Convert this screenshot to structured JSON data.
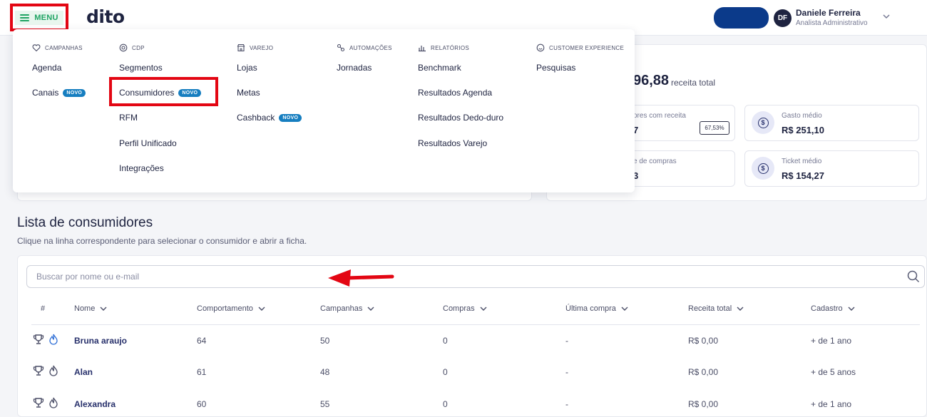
{
  "header": {
    "menu_label": "MENU",
    "logo": "dito",
    "user": {
      "initials": "DF",
      "name": "Daniele Ferreira",
      "role": "Analista Administrativo"
    }
  },
  "menu": {
    "columns": [
      {
        "category": "CAMPANHAS",
        "icon": "heart-icon",
        "items": [
          {
            "label": "Agenda"
          },
          {
            "label": "Canais",
            "badge": "NOVO"
          }
        ]
      },
      {
        "category": "CDP",
        "icon": "cdp-icon",
        "items": [
          {
            "label": "Segmentos"
          },
          {
            "label": "Consumidores",
            "badge": "NOVO"
          },
          {
            "label": "RFM"
          },
          {
            "label": "Perfil Unificado"
          },
          {
            "label": "Integrações"
          }
        ]
      },
      {
        "category": "VAREJO",
        "icon": "store-icon",
        "items": [
          {
            "label": "Lojas"
          },
          {
            "label": "Metas"
          },
          {
            "label": "Cashback",
            "badge": "NOVO"
          }
        ]
      },
      {
        "category": "AUTOMAÇÕES",
        "icon": "automation-icon",
        "items": [
          {
            "label": "Jornadas"
          }
        ]
      },
      {
        "category": "RELATÓRIOS",
        "icon": "chart-icon",
        "items": [
          {
            "label": "Benchmark"
          },
          {
            "label": "Resultados Agenda"
          },
          {
            "label": "Resultados Dedo-duro"
          },
          {
            "label": "Resultados Varejo"
          }
        ]
      },
      {
        "category": "CUSTOMER EXPERIENCE",
        "icon": "smile-icon",
        "items": [
          {
            "label": "Pesquisas"
          }
        ]
      }
    ]
  },
  "summary": {
    "revenue_value": "96,88",
    "revenue_label": "receita total",
    "stats": [
      {
        "label": "ores com receita",
        "value": "7",
        "badge": "67,53%"
      },
      {
        "label": "Gasto médio",
        "value": "R$ 251,10"
      },
      {
        "label": "e de compras",
        "value": "3"
      },
      {
        "label": "Ticket médio",
        "value": "R$ 154,27"
      }
    ]
  },
  "list": {
    "title": "Lista de consumidores",
    "subtitle": "Clique na linha correspondente para selecionar o consumidor e abrir a ficha.",
    "search_placeholder": "Buscar por nome ou e-mail",
    "columns": [
      "#",
      "Nome",
      "Comportamento",
      "Campanhas",
      "Compras",
      "Última compra",
      "Receita total",
      "Cadastro"
    ],
    "rows": [
      {
        "name": "Bruna araujo",
        "comportamento": "64",
        "campanhas": "50",
        "compras": "0",
        "ultima_compra": "-",
        "receita": "R$ 0,00",
        "cadastro": "+ de 1 ano",
        "flame_color": "#2f6fd6"
      },
      {
        "name": "Alan",
        "comportamento": "61",
        "campanhas": "48",
        "compras": "0",
        "ultima_compra": "-",
        "receita": "R$ 0,00",
        "cadastro": "+ de 5 anos",
        "flame_color": "#4a4d66"
      },
      {
        "name": "Alexandra",
        "comportamento": "60",
        "campanhas": "55",
        "compras": "0",
        "ultima_compra": "-",
        "receita": "R$ 0,00",
        "cadastro": "+ de 1 ano",
        "flame_color": "#4a4d66"
      }
    ]
  },
  "colors": {
    "accent_green": "#1fa463",
    "annotation_red": "#e30613",
    "badge_blue": "#167ec0",
    "navy": "#1e2340"
  }
}
